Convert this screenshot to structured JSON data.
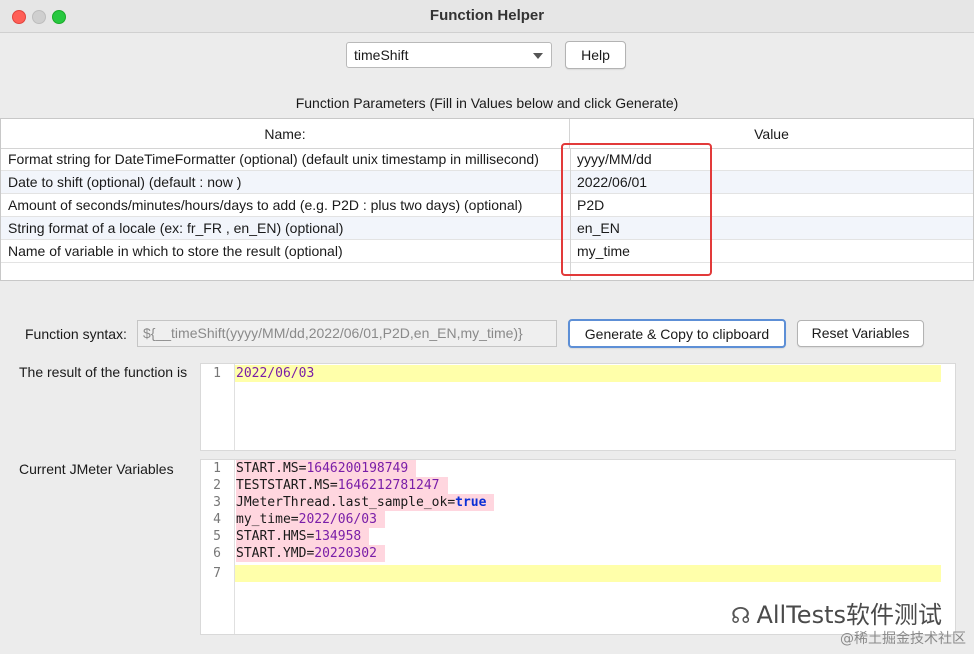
{
  "window": {
    "title": "Function Helper"
  },
  "function_select": {
    "selected": "timeShift"
  },
  "help_button": {
    "label": "Help"
  },
  "params": {
    "caption": "Function Parameters (Fill in Values below and click Generate)",
    "headers": {
      "name": "Name:",
      "value": "Value"
    },
    "rows": [
      {
        "name": "Format string for DateTimeFormatter (optional) (default unix timestamp in millisecond)",
        "value": "yyyy/MM/dd"
      },
      {
        "name": "Date to shift (optional) (default : now )",
        "value": "2022/06/01"
      },
      {
        "name": "Amount of seconds/minutes/hours/days to add (e.g. P2D : plus two days) (optional)",
        "value": "P2D"
      },
      {
        "name": "String format of a locale (ex: fr_FR , en_EN) (optional)",
        "value": "en_EN"
      },
      {
        "name": "Name of variable in which to store the result (optional)",
        "value": "my_time"
      }
    ]
  },
  "syntax": {
    "label": "Function syntax:",
    "value": "${__timeShift(yyyy/MM/dd,2022/06/01,P2D,en_EN,my_time)}"
  },
  "buttons": {
    "generate": "Generate & Copy to clipboard",
    "reset": "Reset Variables"
  },
  "result": {
    "label": "The result of the function is",
    "lines": [
      {
        "num": "1",
        "text": "2022/06/03"
      }
    ]
  },
  "variables": {
    "label": "Current JMeter Variables",
    "lines": [
      {
        "num": "1",
        "key": "START.MS",
        "eq": "=",
        "val": "1646200198749"
      },
      {
        "num": "2",
        "key": "TESTSTART.MS",
        "eq": "=",
        "val": "1646212781247"
      },
      {
        "num": "3",
        "key": "JMeterThread.last_sample_ok",
        "eq": "=",
        "val": "true"
      },
      {
        "num": "4",
        "key": "my_time",
        "eq": "=",
        "val": "2022/06/03"
      },
      {
        "num": "5",
        "key": "START.HMS",
        "eq": "=",
        "val": "134958"
      },
      {
        "num": "6",
        "key": "START.YMD",
        "eq": "=",
        "val": "20220302"
      },
      {
        "num": "7",
        "key": "",
        "eq": "",
        "val": ""
      }
    ]
  },
  "watermark": {
    "main": "AllTests软件测试",
    "sub": "@稀土掘金技术社区"
  },
  "colors": {
    "highlight_border": "#e23a3a",
    "current_line": "#ffffaa",
    "keyword": "#0b2fd6",
    "value": "#7a1ea8"
  },
  "icons": {
    "select_arrow": "chevron-down-icon",
    "watermark": "wechat-icon"
  }
}
